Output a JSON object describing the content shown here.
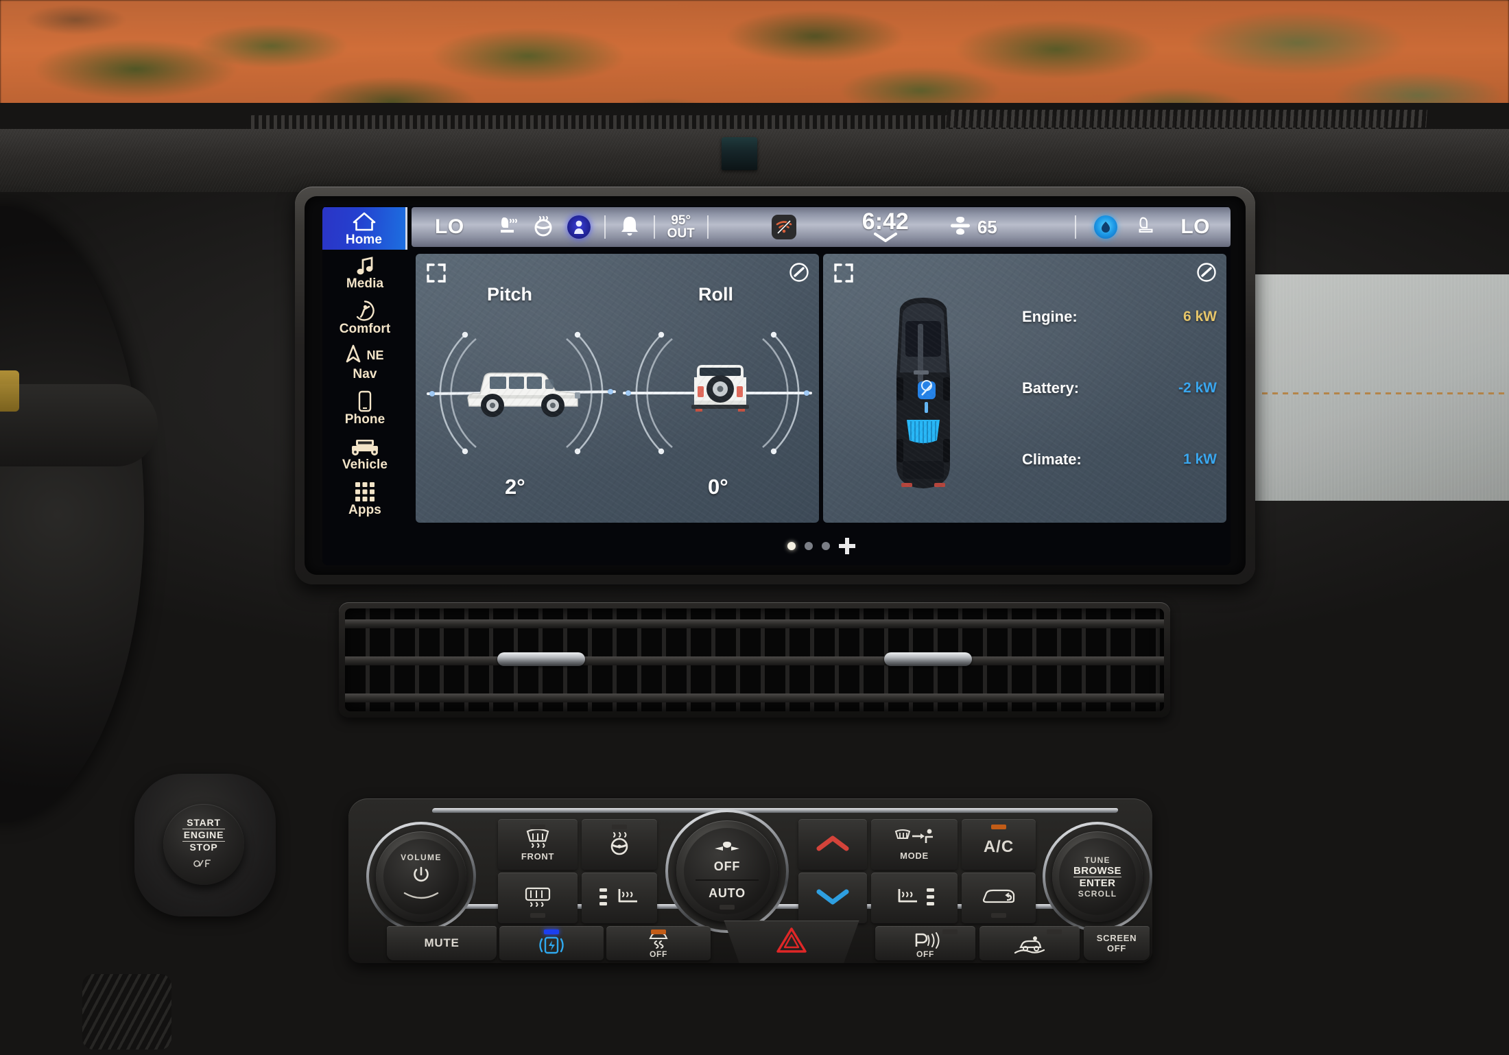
{
  "scene": {
    "name": "desert-dune-windshield-view"
  },
  "head_unit": {
    "nav_rail": {
      "items": [
        {
          "id": "home",
          "label": "Home",
          "icon": "home-icon",
          "active": true
        },
        {
          "id": "media",
          "label": "Media",
          "icon": "music-note-icon",
          "active": false
        },
        {
          "id": "comfort",
          "label": "Comfort",
          "icon": "comfort-seat-icon",
          "active": false
        },
        {
          "id": "nav",
          "label": "Nav",
          "icon": "navigation-arrow-icon",
          "active": false,
          "heading": "NE"
        },
        {
          "id": "phone",
          "label": "Phone",
          "icon": "phone-icon",
          "active": false
        },
        {
          "id": "vehicle",
          "label": "Vehicle",
          "icon": "jeep-front-icon",
          "active": false
        },
        {
          "id": "apps",
          "label": "Apps",
          "icon": "grid-apps-icon",
          "active": false
        }
      ]
    },
    "status_bar": {
      "left_temp": "LO",
      "driver_seat_icon": "heated-seat-icon",
      "steering_wheel_icon": "heated-steering-wheel-icon",
      "assistant_icon": "voice-assistant-icon",
      "notification_icon": "bell-icon",
      "outside_temp": "95°",
      "outside_temp_unit": "OUT",
      "connectivity_icon": "wifi-off-icon",
      "clock": "6:42",
      "clock_chevron_icon": "chevron-down-icon",
      "fan_icon": "fan-icon",
      "fan_speed": "65",
      "right_indicator_icon": "blue-status-dot-icon",
      "passenger_seat_icon": "heated-seat-icon",
      "right_temp": "LO"
    },
    "widgets": [
      {
        "id": "pitch-roll",
        "expand_icon": "expand-icon",
        "edit_icon": "edit-slash-icon",
        "gauges": [
          {
            "id": "pitch",
            "title": "Pitch",
            "value": "2°",
            "vehicle_view": "jeep-side-view"
          },
          {
            "id": "roll",
            "title": "Roll",
            "value": "0°",
            "vehicle_view": "jeep-rear-view"
          }
        ]
      },
      {
        "id": "power-flow",
        "expand_icon": "expand-icon",
        "edit_icon": "edit-slash-icon",
        "vehicle_view": "jeep-top-down-view",
        "rows": [
          {
            "label": "Engine:",
            "value": "6 kW",
            "color": "#e8c76a"
          },
          {
            "label": "Battery:",
            "value": "-2 kW",
            "color": "#39a7f0"
          },
          {
            "label": "Climate:",
            "value": "1 kW",
            "color": "#39a7f0"
          }
        ]
      }
    ],
    "pager": {
      "dots": 3,
      "active_index": 0,
      "add_icon": "plus-icon"
    }
  },
  "ignition": {
    "lines": [
      "START",
      "ENGINE",
      "STOP"
    ],
    "sub_icon": "ignition-key-icon"
  },
  "climate_panel": {
    "volume_knob": {
      "label": "VOLUME",
      "icon": "power-icon"
    },
    "fan_knob": {
      "top_label": "OFF",
      "top_icon": "fan-icon",
      "bottom_label": "AUTO"
    },
    "tune_knob": {
      "top_label": "TUNE",
      "mid_label": "BROWSE",
      "mid2_label": "ENTER",
      "bottom_label": "SCROLL"
    },
    "buttons": [
      {
        "id": "front-defrost",
        "label": "FRONT",
        "icon": "front-defrost-icon",
        "led": "dark"
      },
      {
        "id": "heated-steering",
        "label": "",
        "icon": "heated-steering-wheel-icon",
        "led": "dark"
      },
      {
        "id": "rear-defrost",
        "label": "",
        "icon": "rear-defrost-icon",
        "led": "dark"
      },
      {
        "id": "driver-seat-heat",
        "label": "",
        "icon": "heated-seat-icon",
        "led": "dark"
      },
      {
        "id": "temp-up",
        "label": "",
        "icon": "chevron-up-icon"
      },
      {
        "id": "temp-down",
        "label": "",
        "icon": "chevron-down-icon"
      },
      {
        "id": "air-mode",
        "label": "MODE",
        "icon": "air-mode-icon",
        "led": "dark"
      },
      {
        "id": "ac",
        "label": "A/C",
        "icon": "",
        "led": "amber"
      },
      {
        "id": "passenger-seat-heat",
        "label": "",
        "icon": "heated-seat-icon",
        "led": "dark"
      },
      {
        "id": "recirculation",
        "label": "",
        "icon": "recirculate-icon",
        "led": "dark"
      }
    ],
    "bottom_buttons": [
      {
        "id": "mute",
        "label": "MUTE",
        "icon": "",
        "led": "dark"
      },
      {
        "id": "battery-save",
        "label": "",
        "icon": "battery-charge-icon",
        "led": "blue"
      },
      {
        "id": "esc-off",
        "label": "OFF",
        "icon": "traction-control-icon",
        "led": "amber"
      },
      {
        "id": "hazard",
        "label": "",
        "icon": "hazard-triangle-icon"
      },
      {
        "id": "park-sense",
        "label": "OFF",
        "icon": "park-sense-icon",
        "led": "dark"
      },
      {
        "id": "hill-descent",
        "label": "",
        "icon": "hill-descent-icon",
        "led": "dark"
      },
      {
        "id": "screen-off",
        "label": "SCREEN",
        "label2": "OFF",
        "icon": "",
        "led": "dark"
      }
    ]
  },
  "colors": {
    "home_accent_start": "#2b35c6",
    "home_accent_end": "#1d6fe0",
    "rail_text": "#f3e4c8",
    "widget_bg": "#4e5b68",
    "engine_value": "#e8c76a",
    "battery_value": "#39a7f0",
    "hazard_red": "#e02727",
    "led_blue": "#1c3ff0"
  }
}
